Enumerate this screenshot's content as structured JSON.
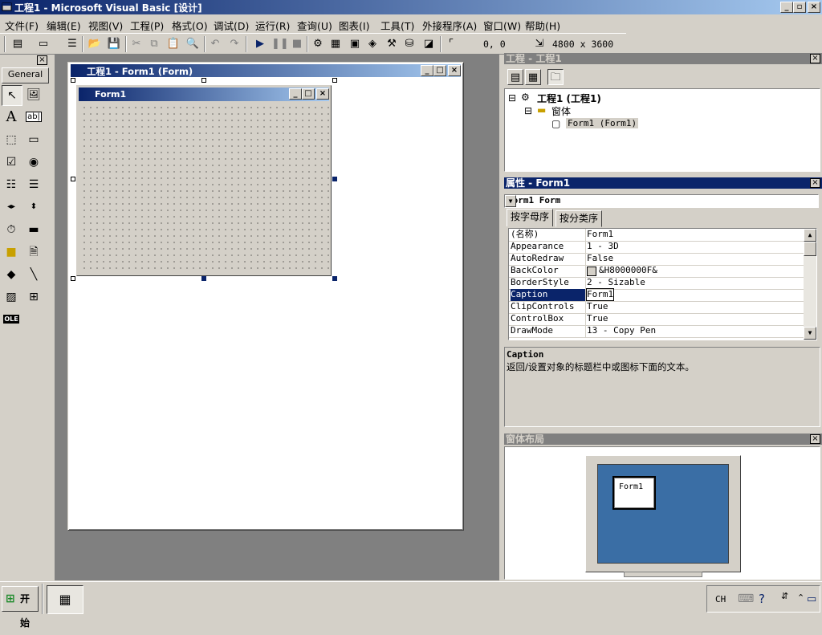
{
  "window": {
    "title": "工程1 - Microsoft Visual Basic [设计]",
    "controls": [
      "_",
      "▫",
      "×"
    ]
  },
  "menu": [
    "文件(F)",
    "编辑(E)",
    "视图(V)",
    "工程(P)",
    "格式(O)",
    "调试(D)",
    "运行(R)",
    "查询(U)",
    "图表(I)",
    "工具(T)",
    "外接程序(A)",
    "窗口(W)",
    "帮助(H)"
  ],
  "toolbar": {
    "position": "0, 0",
    "size": "4800 x 3600"
  },
  "toolbox": {
    "tab": "General"
  },
  "designer": {
    "title": "工程1 - Form1 (Form)",
    "form_caption": "Form1"
  },
  "project_panel": {
    "title": "工程 - 工程1",
    "tree": {
      "root": "工程1 (工程1)",
      "folder": "窗体",
      "item": "Form1 (Form1)"
    }
  },
  "properties_panel": {
    "title": "属性 - Form1",
    "object": "Form1 Form",
    "tabs": [
      "按字母序",
      "按分类序"
    ],
    "rows": [
      {
        "name": "(名称)",
        "value": "Form1"
      },
      {
        "name": "Appearance",
        "value": "1 - 3D"
      },
      {
        "name": "AutoRedraw",
        "value": "False"
      },
      {
        "name": "BackColor",
        "value": "&H8000000F&"
      },
      {
        "name": "BorderStyle",
        "value": "2 - Sizable"
      },
      {
        "name": "Caption",
        "value": "Form1"
      },
      {
        "name": "ClipControls",
        "value": "True"
      },
      {
        "name": "ControlBox",
        "value": "True"
      },
      {
        "name": "DrawMode",
        "value": "13 - Copy Pen"
      }
    ],
    "selected_row": "Caption",
    "description": {
      "name": "Caption",
      "text": "返回/设置对象的标题栏中或图标下面的文本。"
    }
  },
  "layout_panel": {
    "title": "窗体布局",
    "form_label": "Form1"
  },
  "taskbar": {
    "start": "开始",
    "lang": "CH"
  },
  "colors": {
    "titlebar": "#0a246a",
    "face": "#d4d0c8",
    "desktop": "#3a6ea5",
    "mdi": "#808080"
  }
}
